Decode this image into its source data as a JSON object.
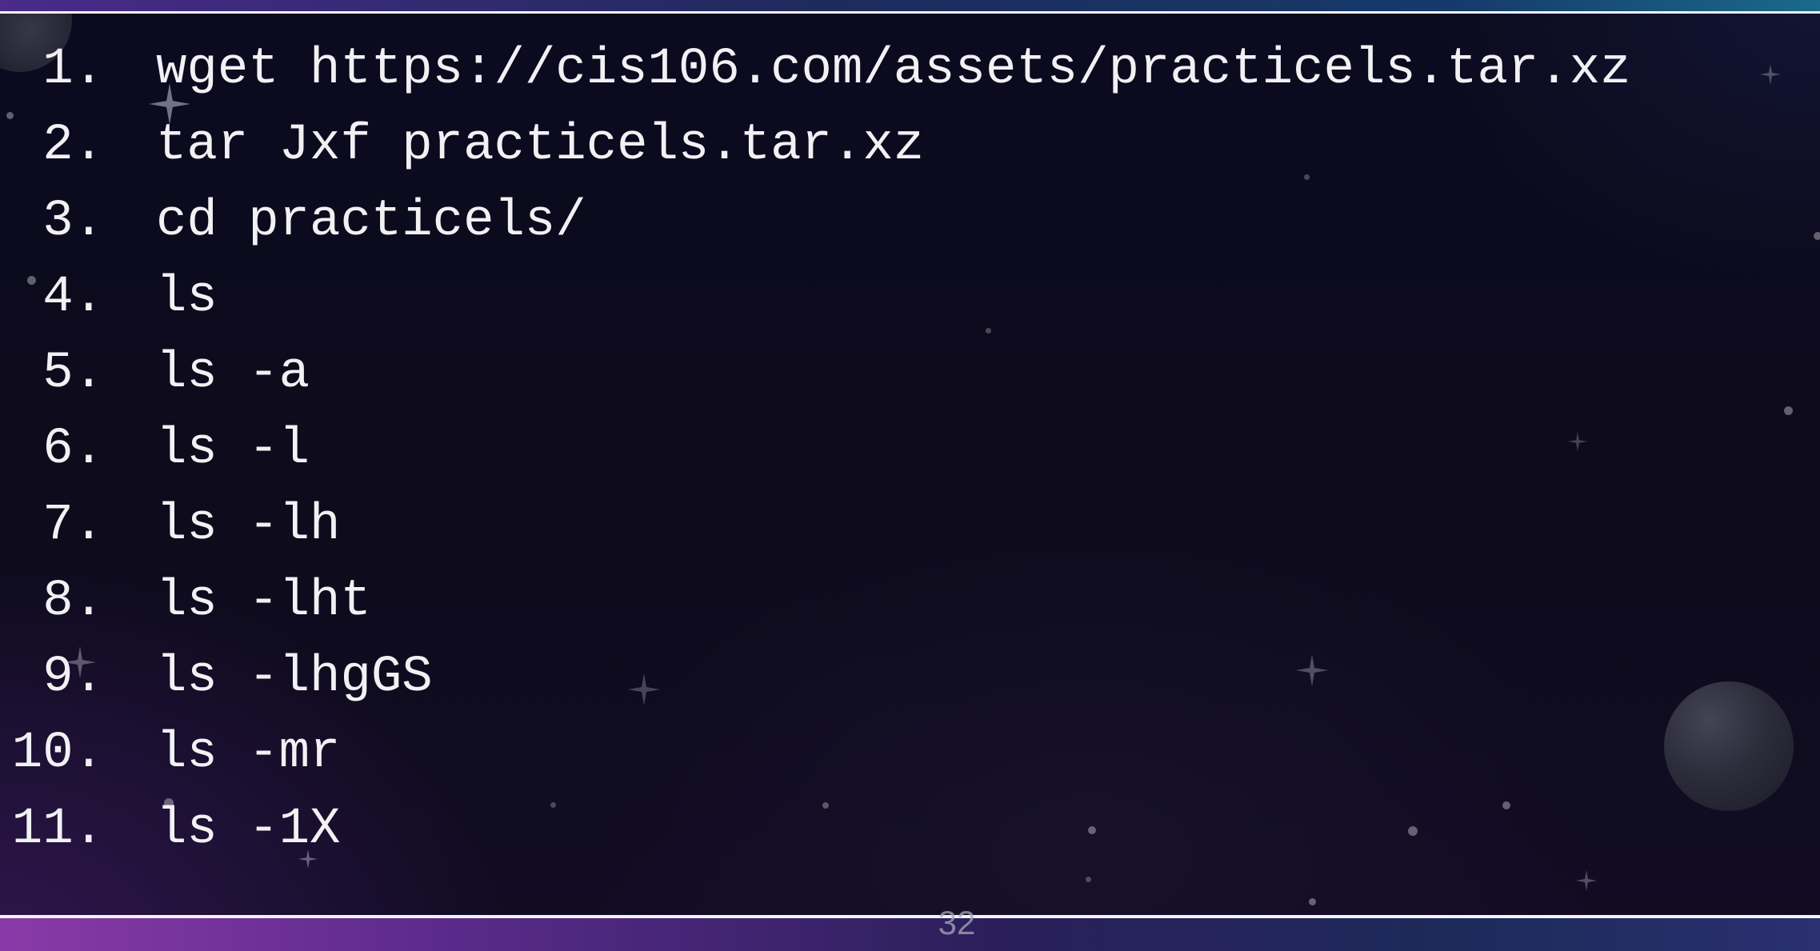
{
  "slide": {
    "page_number": "32",
    "commands": [
      {
        "num": "1.",
        "cmd": "wget https://cis106.com/assets/practicels.tar.xz"
      },
      {
        "num": "2.",
        "cmd": "tar Jxf practicels.tar.xz"
      },
      {
        "num": "3.",
        "cmd": "cd practicels/"
      },
      {
        "num": "4.",
        "cmd": "ls"
      },
      {
        "num": "5.",
        "cmd": "ls -a"
      },
      {
        "num": "6.",
        "cmd": "ls -l"
      },
      {
        "num": "7.",
        "cmd": "ls -lh"
      },
      {
        "num": "8.",
        "cmd": "ls -lht"
      },
      {
        "num": "9.",
        "cmd": "ls -lhgGS"
      },
      {
        "num": "10.",
        "cmd": "ls -mr"
      },
      {
        "num": "11.",
        "cmd": "ls -1X"
      }
    ]
  },
  "colors": {
    "background": "#0c0a1e",
    "text": "#f1f1f4",
    "rule": "#f3f3f7",
    "accent_purple": "#8a3aa8"
  },
  "icons": [
    "star-icon",
    "sparkle-icon",
    "planet-icon"
  ]
}
